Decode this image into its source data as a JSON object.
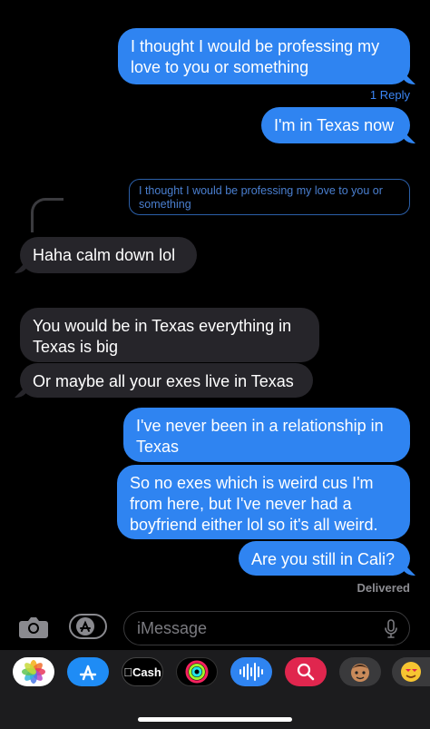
{
  "messages": [
    {
      "id": "m1",
      "text": "I thought I would be professing my love to you or something"
    },
    {
      "id": "m2",
      "text": "I'm in Texas now"
    },
    {
      "id": "m3",
      "text": "Haha calm down lol"
    },
    {
      "id": "m4",
      "text": "You would be in Texas everything in Texas is big"
    },
    {
      "id": "m5",
      "text": "Or maybe all your exes live in Texas"
    },
    {
      "id": "m6",
      "text": "I've never been in a relationship in Texas"
    },
    {
      "id": "m7",
      "text": "So no exes which is weird cus I'm from here, but I've never had a boyfriend either lol so it's all weird."
    },
    {
      "id": "m8",
      "text": "Are you still in Cali?"
    }
  ],
  "reply_count": "1 Reply",
  "quoted_text": "I thought I would be professing my love to you or something",
  "status": "Delivered",
  "input": {
    "placeholder": "iMessage"
  },
  "drawer": {
    "apps": [
      {
        "name": "Photos",
        "icon": "photos-icon"
      },
      {
        "name": "App Store",
        "icon": "app-store-icon"
      },
      {
        "name": "Cash",
        "label": "Cash",
        "icon": "apple-cash-icon"
      },
      {
        "name": "Activity",
        "icon": "activity-rings-icon"
      },
      {
        "name": "Audio",
        "icon": "audio-waveform-icon"
      },
      {
        "name": "Search",
        "icon": "image-search-icon"
      },
      {
        "name": "Memoji",
        "icon": "memoji-icon"
      },
      {
        "name": "Memoji Stickers",
        "icon": "memoji-stickers-icon"
      }
    ]
  },
  "colors": {
    "outgoing": "#2f84f1",
    "incoming": "#26252a",
    "background": "#000000",
    "link": "#3b86f6",
    "meta": "#8d8d92"
  }
}
